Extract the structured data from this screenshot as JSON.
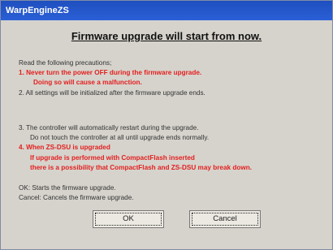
{
  "window": {
    "title": "WarpEngineZS"
  },
  "heading": "Firmware upgrade will start from now.",
  "lines": [
    {
      "text": "Read the following precautions;",
      "style": "normal"
    },
    {
      "text": "1. Never turn the power OFF during the firmware upgrade.",
      "style": "red"
    },
    {
      "text": "Doing so will cause a malfunction.",
      "style": "red"
    },
    {
      "text": "2. All settings will be initialized after the firmware upgrade ends.",
      "style": "normal"
    },
    {
      "text": "3. The controller will automatically restart during the upgrade.",
      "style": "normal"
    },
    {
      "text": "Do not touch the controller at all until upgrade ends normally.",
      "style": "normal"
    },
    {
      "text": "4. When ZS-DSU is upgraded",
      "style": "red"
    },
    {
      "text": "If upgrade is performed with CompactFlash inserted",
      "style": "red"
    },
    {
      "text": "there is a possibility that CompactFlash and ZS-DSU may break down.",
      "style": "red"
    },
    {
      "text": "OK:     Starts the firmware upgrade.",
      "style": "normal"
    },
    {
      "text": "Cancel: Cancels the firmware upgrade.",
      "style": "normal"
    }
  ],
  "buttons": {
    "ok": "OK",
    "cancel": "Cancel"
  }
}
